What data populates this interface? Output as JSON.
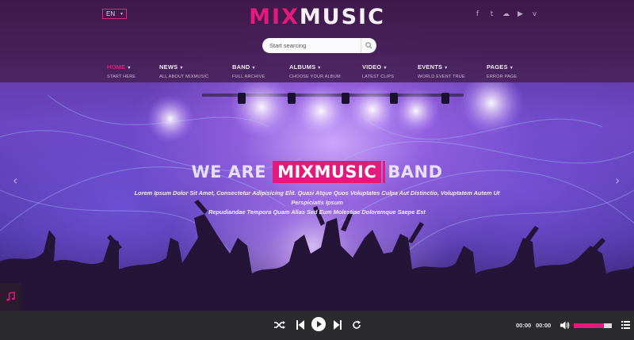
{
  "header": {
    "language": "EN",
    "logo_mix": "MIX",
    "logo_music": "MUSIC",
    "socials": [
      {
        "icon": "facebook-icon",
        "glyph": "f"
      },
      {
        "icon": "twitter-icon",
        "glyph": "t"
      },
      {
        "icon": "soundcloud-icon",
        "glyph": "☁"
      },
      {
        "icon": "youtube-icon",
        "glyph": "▶"
      },
      {
        "icon": "vimeo-icon",
        "glyph": "v"
      }
    ],
    "search": {
      "placeholder": "Start searcing"
    }
  },
  "nav": [
    {
      "label": "HOME",
      "sub": "START HERE",
      "active": true
    },
    {
      "label": "NEWS",
      "sub": "ALL ABOUT MIXMUSIC",
      "active": false
    },
    {
      "label": "BAND",
      "sub": "FULL ARCHIVE",
      "active": false
    },
    {
      "label": "ALBUMS",
      "sub": "CHOOSE YOUR ALBUM",
      "active": false
    },
    {
      "label": "VIDEO",
      "sub": "LATEST CLIPS",
      "active": false
    },
    {
      "label": "EVENTS",
      "sub": "WORLD EVENT TRUE",
      "active": false
    },
    {
      "label": "PAGES",
      "sub": "ERROR PAGE",
      "active": false
    }
  ],
  "hero": {
    "headline_before": "WE ARE",
    "headline_highlight": "MIXMUSIC",
    "headline_after": "BAND",
    "text_line1": "Lorem Ipsum Dolor Sit Amet, Consectetur Adipisicing Elit. Quasi Atque Quos Voluptates Culpa Aut Distinctio, Voluptatem Autem Ut Perspiciatis Ipsum",
    "text_line2": "Repudiandae Tempora Quam Alias Sed Eum Molestiae Doloremque Saepe Est"
  },
  "player": {
    "current_time": "00:00",
    "duration": "00:00",
    "volume": 0.8
  },
  "colors": {
    "accent": "#e4197b",
    "player_bg": "#2b2b2d"
  }
}
